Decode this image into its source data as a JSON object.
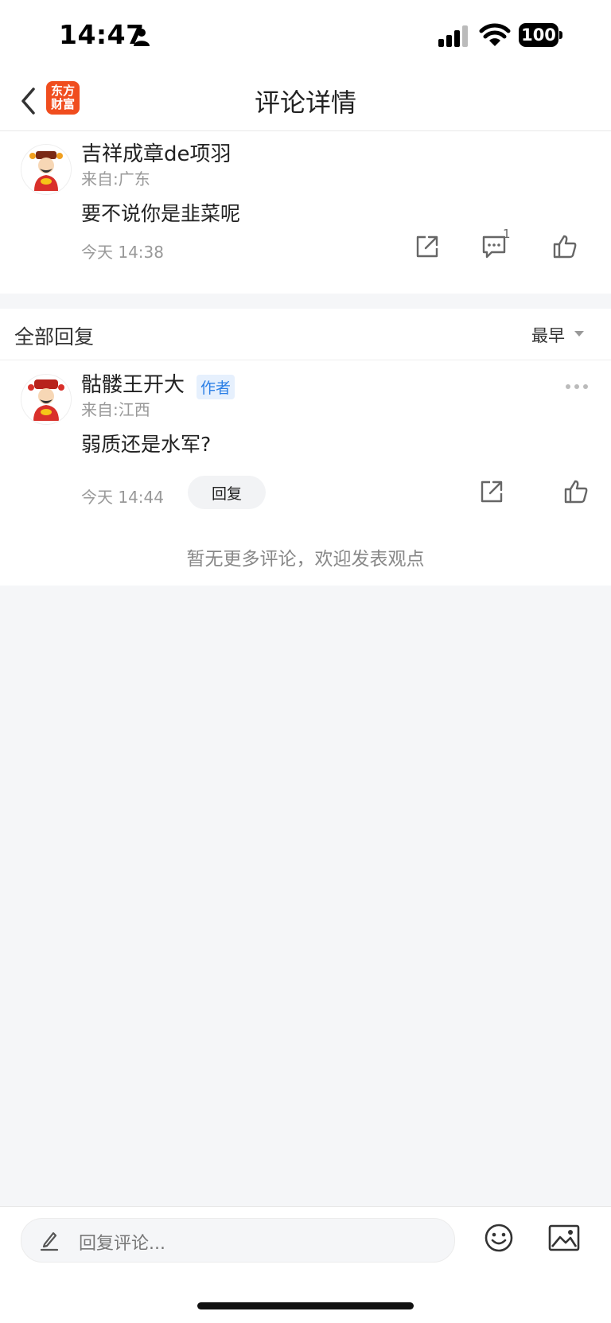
{
  "status_bar": {
    "time": "14:47",
    "battery": "100"
  },
  "nav": {
    "title": "评论详情",
    "logo_line1": "东方",
    "logo_line2": "财富"
  },
  "main_comment": {
    "username": "吉祥成章de项羽",
    "location": "来自:广东",
    "content": "要不说你是韭菜呢",
    "time": "今天 14:38",
    "comment_count": "1"
  },
  "replies_section": {
    "title": "全部回复",
    "sort": "最早"
  },
  "reply": {
    "username": "骷髅王开大",
    "badge": "作者",
    "location": "来自:江西",
    "content": "弱质还是水军?",
    "time": "今天 14:44",
    "reply_button": "回复"
  },
  "empty_hint": "暂无更多评论，欢迎发表观点",
  "bottom_bar": {
    "placeholder": "回复评论..."
  },
  "colors": {
    "brand": "#f04d1e",
    "author_badge": "#2b7fe6",
    "background": "#f5f6f8"
  }
}
